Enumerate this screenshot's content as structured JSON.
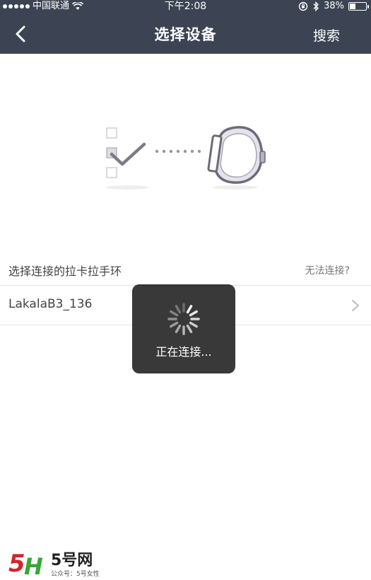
{
  "status_bar": {
    "carrier": "中国联通",
    "time": "下午2:08",
    "battery": "38%",
    "battery_level": 0.38
  },
  "nav": {
    "title": "选择设备",
    "search_label": "搜索",
    "back_icon": "chevron-left-icon"
  },
  "section": {
    "title": "选择连接的拉卡拉手环",
    "help_link": "无法连接?"
  },
  "devices": [
    {
      "name": "LakalaB3_136"
    }
  ],
  "toast": {
    "message": "正在连接..."
  },
  "watermark": {
    "logo_text": "5H",
    "site_name": "5号网",
    "subtitle": "公众号：5号女性"
  },
  "colors": {
    "header_bg": "#3c4453",
    "accent_green": "#3aa635",
    "watermark_red": "#d0262c"
  }
}
